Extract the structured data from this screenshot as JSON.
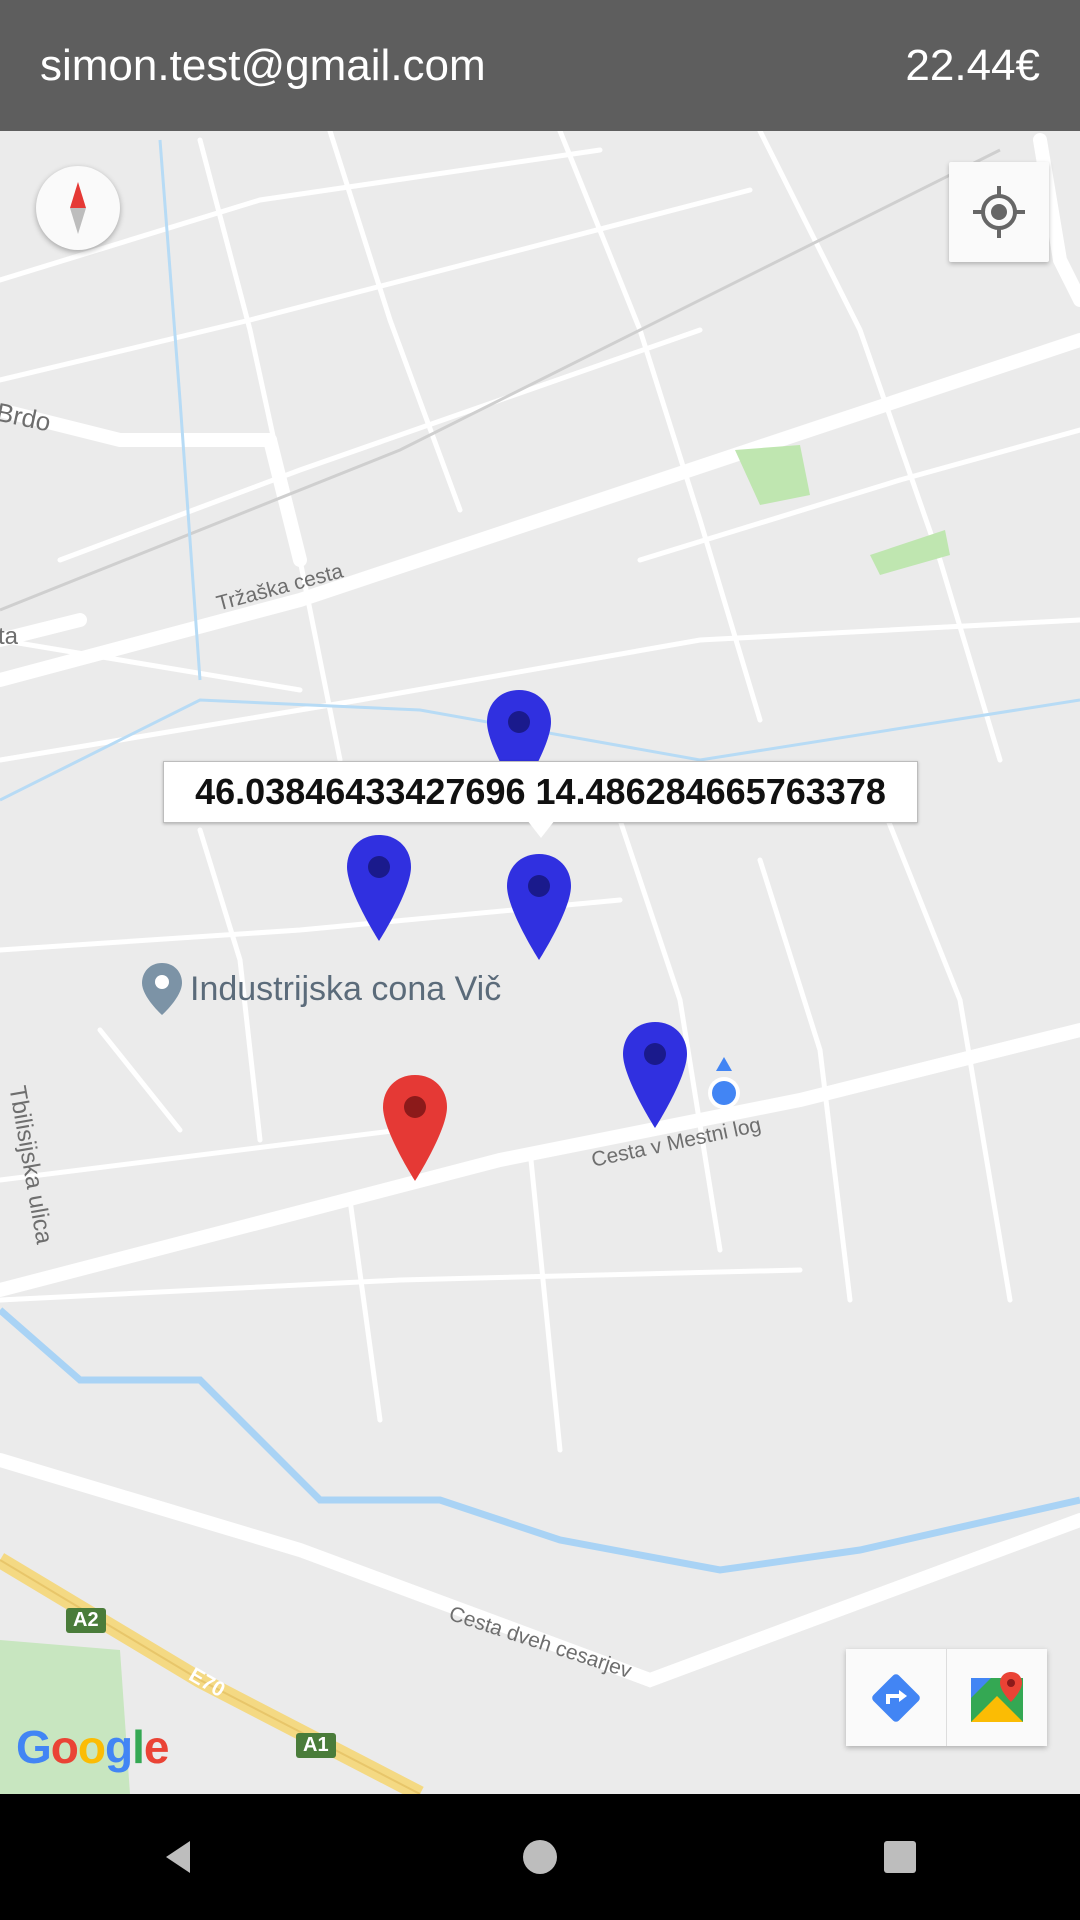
{
  "header": {
    "email": "simon.test@gmail.com",
    "balance": "22.44€"
  },
  "map": {
    "tooltip": "46.03846433427696 14.486284665763378",
    "poi": {
      "label": "Industrijska cona Vič",
      "icon": "place-pin-icon"
    },
    "streets": {
      "brdo": "Brdo",
      "trzaska": "Tržaška cesta",
      "ta": "ta",
      "cesta_mestni_log": "Cesta v Mestni log",
      "thilisijska": "Tbilisijska ulica",
      "cesta_dveh_cesarjev": "Cesta dveh cesarjev"
    },
    "shields": {
      "a2": "A2",
      "a1": "A1",
      "e70": "E70"
    },
    "markers": [
      {
        "color": "#3030e0",
        "kind": "blue"
      },
      {
        "color": "#3030e0",
        "kind": "blue"
      },
      {
        "color": "#3030e0",
        "kind": "blue"
      },
      {
        "color": "#3030e0",
        "kind": "blue"
      },
      {
        "color": "#e53935",
        "kind": "red"
      }
    ],
    "attribution": "Google"
  },
  "colors": {
    "header_bg": "#5e5e5e",
    "marker_blue": "#3030e0",
    "marker_red": "#e53935",
    "user_dot": "#4285f4"
  },
  "icons": {
    "compass": "compass-icon",
    "my_location": "my-location-icon",
    "directions": "directions-icon",
    "maps": "google-maps-icon"
  },
  "nav": {
    "back": "back-icon",
    "home": "home-icon",
    "recents": "recents-icon"
  }
}
